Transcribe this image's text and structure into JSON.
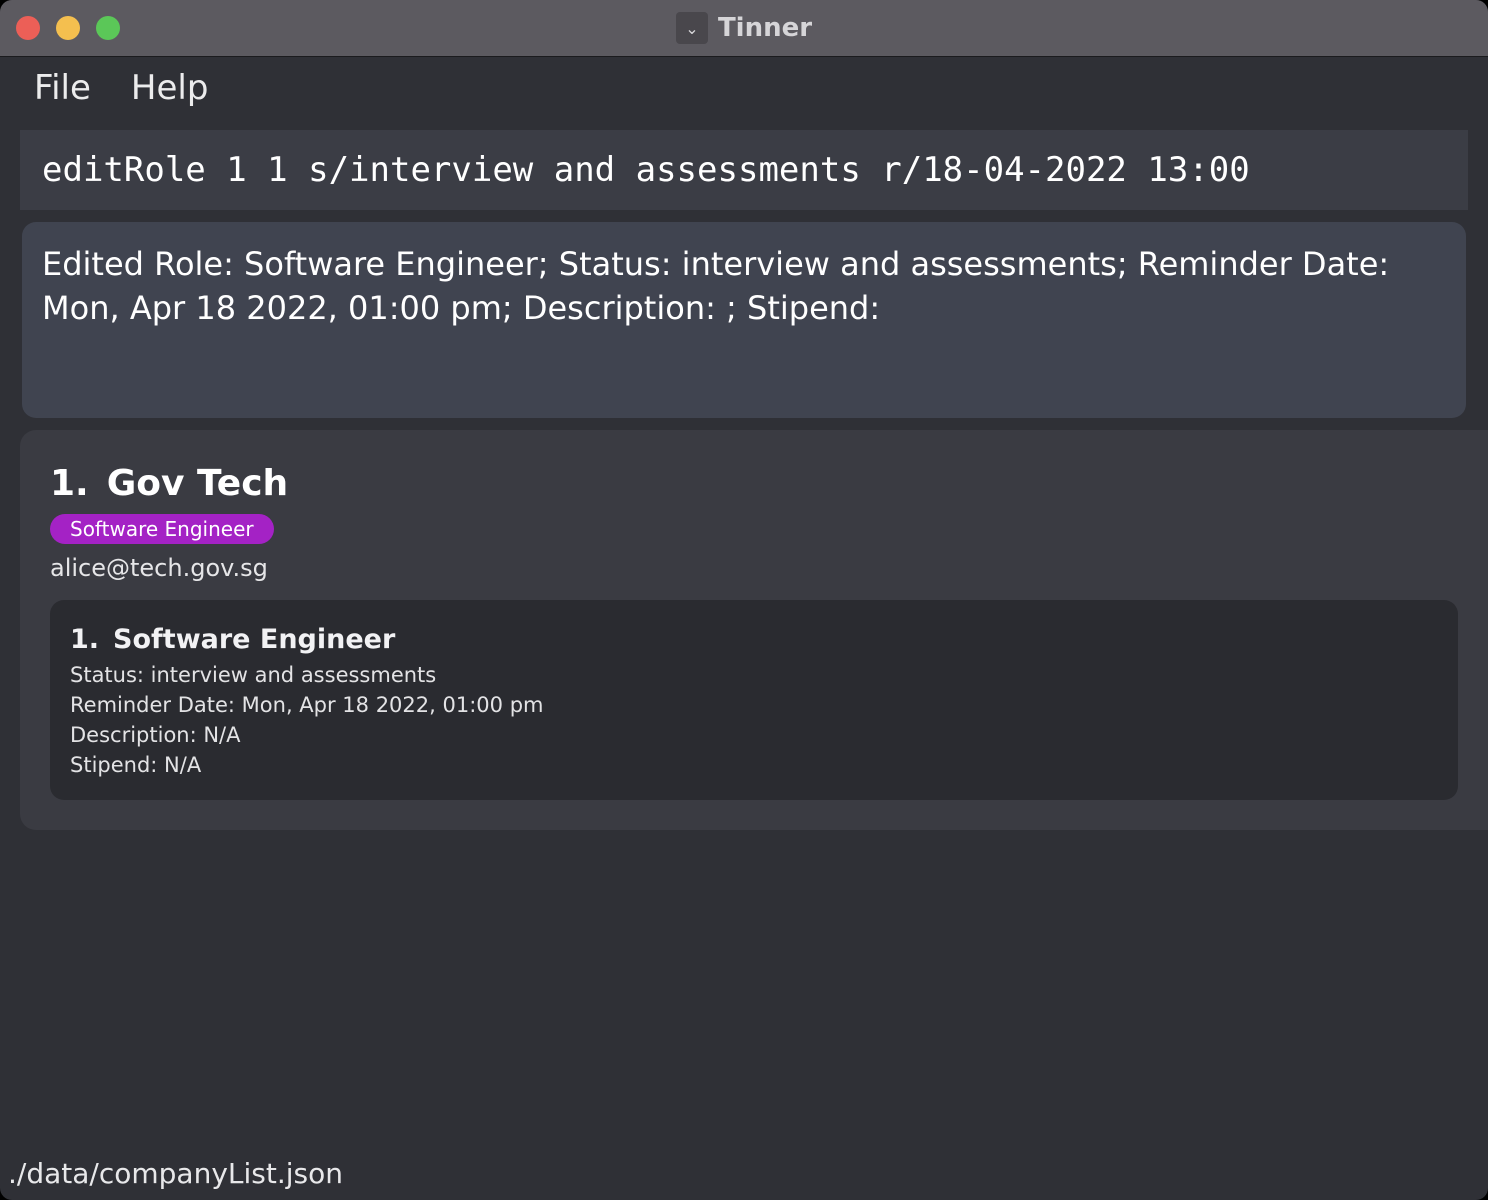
{
  "window": {
    "title": "Tinner",
    "app_icon": "chevron-down-icon"
  },
  "menu": {
    "items": [
      "File",
      "Help"
    ]
  },
  "command": {
    "value": "editRole 1 1 s/interview and assessments r/18-04-2022 13:00"
  },
  "result": {
    "text": "Edited Role: Software Engineer; Status: interview and assessments; Reminder Date: Mon, Apr 18 2022, 01:00 pm; Description: ; Stipend:"
  },
  "companies": [
    {
      "index": "1.",
      "name": "Gov Tech",
      "tag": "Software Engineer",
      "email": "alice@tech.gov.sg",
      "roles": [
        {
          "index": "1.",
          "name": "Software Engineer",
          "status": "Status: interview and assessments",
          "reminder": "Reminder Date: Mon, Apr 18 2022, 01:00 pm",
          "description": "Description: N/A",
          "stipend": "Stipend: N/A"
        }
      ]
    }
  ],
  "status_bar": {
    "path": "./data/companyList.json"
  },
  "colors": {
    "background": "#2f3036",
    "titlebar": "#5c5a60",
    "tag": "#a422c5",
    "result_box": "#404450",
    "role_card": "#2a2b30"
  }
}
